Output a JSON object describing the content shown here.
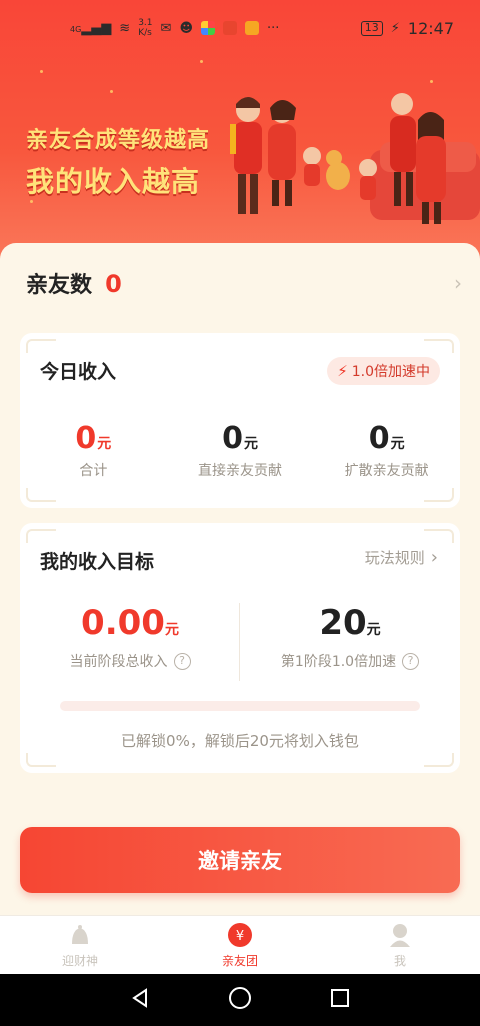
{
  "status_bar": {
    "network": "4G",
    "speed_value": "3.1",
    "speed_unit": "K/s",
    "more": "···",
    "battery": "13",
    "time": "12:47"
  },
  "banner": {
    "line1": "亲友合成等级越高",
    "line2": "我的收入越高"
  },
  "friends": {
    "label": "亲友数",
    "count": "0"
  },
  "today_income": {
    "title": "今日收入",
    "speed_badge": "1.0倍加速中",
    "stats": [
      {
        "value": "0",
        "unit": "元",
        "label": "合计"
      },
      {
        "value": "0",
        "unit": "元",
        "label": "直接亲友贡献"
      },
      {
        "value": "0",
        "unit": "元",
        "label": "扩散亲友贡献"
      }
    ]
  },
  "goal": {
    "title": "我的收入目标",
    "rules_link": "玩法规则",
    "current_value": "0.00",
    "current_unit": "元",
    "current_label": "当前阶段总收入",
    "target_value": "20",
    "target_unit": "元",
    "target_label": "第1阶段1.0倍加速",
    "progress_fraction": 0,
    "progress_text": "已解锁0%，解锁后20元将划入钱包"
  },
  "invite_button": "邀请亲友",
  "tabs": [
    {
      "label": "迎财神",
      "icon": "deity-icon",
      "active": false
    },
    {
      "label": "亲友团",
      "icon": "yuan-coin-icon",
      "active": true
    },
    {
      "label": "我",
      "icon": "user-icon",
      "active": false
    }
  ],
  "colors": {
    "accent": "#f0392b",
    "banner_title": "#ffe37a",
    "sheet_bg": "#fdf6e8"
  }
}
